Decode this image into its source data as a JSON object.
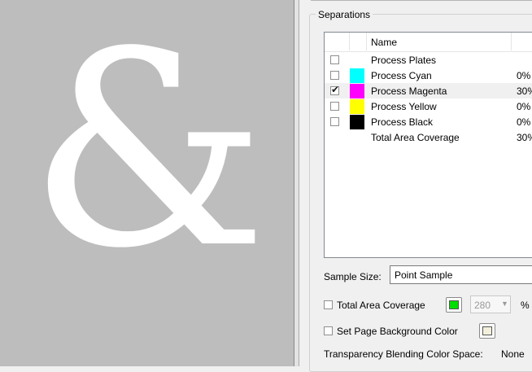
{
  "preview": {
    "glyph": "&"
  },
  "separations": {
    "title": "Separations",
    "column_name": "Name",
    "rows": [
      {
        "label": "Process Plates",
        "checked": false,
        "swatch": null,
        "percent": ""
      },
      {
        "label": "Process Cyan",
        "checked": false,
        "swatch": "#00ffff",
        "percent": "0%"
      },
      {
        "label": "Process Magenta",
        "checked": true,
        "swatch": "#ff00ff",
        "percent": "30%"
      },
      {
        "label": "Process Yellow",
        "checked": false,
        "swatch": "#ffff00",
        "percent": "0%"
      },
      {
        "label": "Process Black",
        "checked": false,
        "swatch": "#000000",
        "percent": "0%"
      },
      {
        "label": "Total Area Coverage",
        "checked": null,
        "swatch": null,
        "percent": "30%"
      }
    ]
  },
  "sample_size": {
    "label": "Sample Size:",
    "value": "Point Sample"
  },
  "total_area_coverage": {
    "label": "Total Area Coverage",
    "checked": false,
    "color": "#00dd00",
    "value": "280",
    "unit": "%"
  },
  "page_background": {
    "label": "Set Page Background Color",
    "checked": false,
    "color": "#f2f0dc"
  },
  "blending": {
    "label": "Transparency Blending Color Space:",
    "value": "None"
  }
}
